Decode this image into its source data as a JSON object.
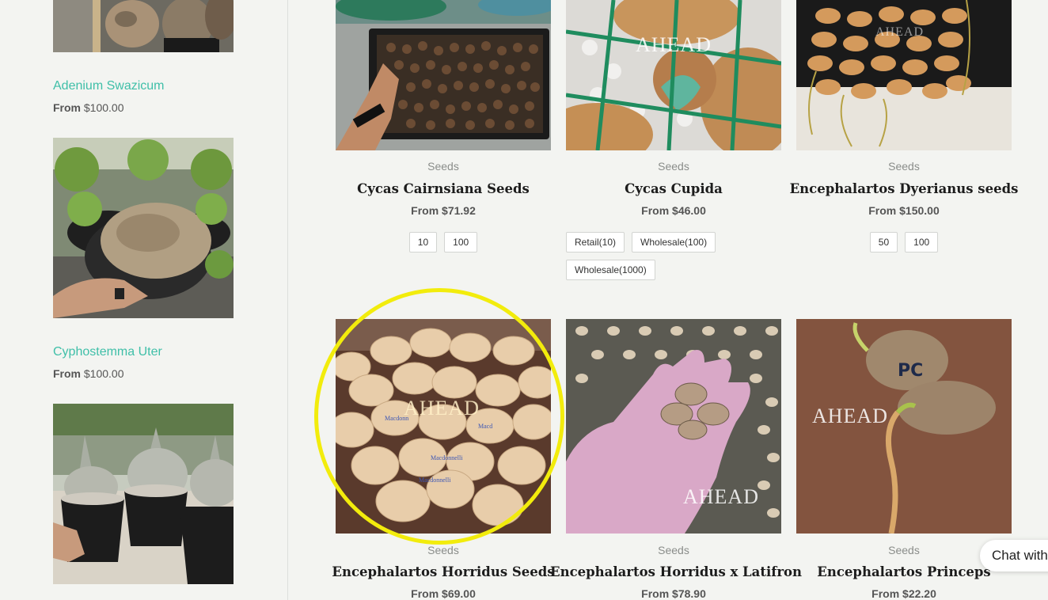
{
  "sidebar": {
    "items": [
      {
        "title": "Adenium Swazicum",
        "price_prefix": "From",
        "price": "$100.00"
      },
      {
        "title": "Cyphostemma Uter",
        "price_prefix": "From",
        "price": "$100.00"
      }
    ]
  },
  "products": [
    {
      "category": "Seeds",
      "name": "Cycas Cairnsiana Seeds",
      "price_prefix": "From",
      "price": "$71.92",
      "options": [
        "10",
        "100"
      ]
    },
    {
      "category": "Seeds",
      "name": "Cycas Cupida",
      "price_prefix": "From",
      "price": "$46.00",
      "options": [
        "Retail(10)",
        "Wholesale(100)",
        "Wholesale(1000)"
      ],
      "watermark": "AHEAD"
    },
    {
      "category": "Seeds",
      "name": "Encephalartos Dyerianus seeds",
      "price_prefix": "From",
      "price": "$150.00",
      "options": [
        "50",
        "100"
      ],
      "watermark": "AHEAD"
    },
    {
      "category": "Seeds",
      "name": "Encephalartos Horridus Seeds",
      "price_prefix": "From",
      "price": "$69.00",
      "watermark": "AHEAD"
    },
    {
      "category": "Seeds",
      "name": "Encephalartos Horridus x Latifron",
      "price_prefix": "From",
      "price": "$78.90",
      "watermark": "AHEAD"
    },
    {
      "category": "Seeds",
      "name": "Encephalartos Princeps",
      "price_prefix": "From",
      "price": "$22.20",
      "watermark": "AHEAD"
    }
  ],
  "chat": {
    "label": "Chat with"
  },
  "colors": {
    "accent": "#3fbfa8",
    "highlight": "#f2ec0c",
    "background": "#f3f4f1"
  }
}
